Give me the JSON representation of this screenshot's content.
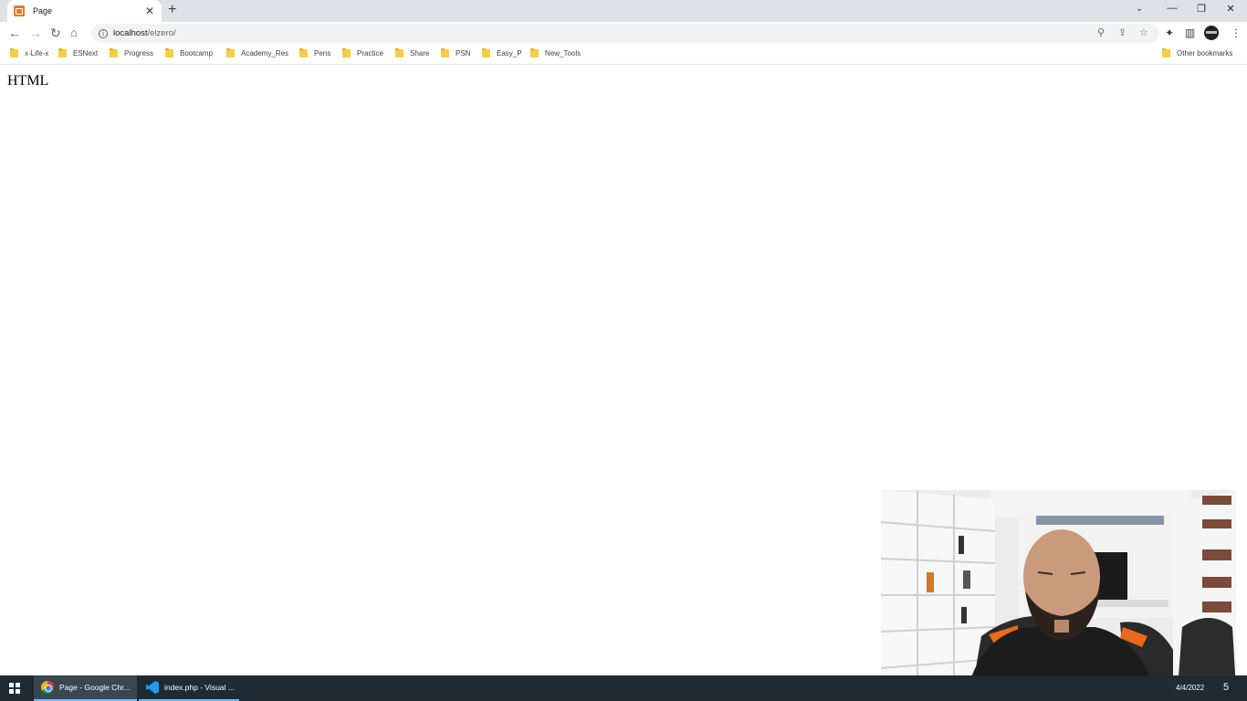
{
  "browser": {
    "tab": {
      "title": "Page",
      "close": "✕"
    },
    "new_tab": "+",
    "window_controls": [
      "⌄",
      "—",
      "❐",
      "✕"
    ],
    "url": {
      "host": "localhost",
      "path": "/elzero/"
    },
    "icons": [
      "back-icon",
      "forward-icon",
      "reload-icon",
      "home-icon",
      "info-icon",
      "zoom-icon",
      "share-icon",
      "star-icon",
      "extensions-icon",
      "side-panel-icon",
      "profile-icon",
      "menu-icon"
    ]
  },
  "bookmarks": {
    "items": [
      "x-Life-x",
      "ESNext",
      "Progress",
      "Bootcamp",
      "Academy_Res",
      "Pens",
      "Practice",
      "Share",
      "PSN",
      "Easy_P",
      "New_Tools"
    ],
    "other": "Other bookmarks"
  },
  "page": {
    "heading": "HTML"
  },
  "taskbar": {
    "items": [
      {
        "label": "Page - Google Chr...",
        "icon": "chrome-icon"
      },
      {
        "label": "index.php - Visual ...",
        "icon": "vscode-icon"
      }
    ],
    "date": "4/4/2022",
    "notification": "5"
  },
  "colors": {
    "tabstrip": "#dee1e6",
    "omnibox": "#f1f3f4",
    "taskbar": "#1f2a33",
    "folder": "#f6cc4b",
    "favicon": "#e8792a"
  }
}
